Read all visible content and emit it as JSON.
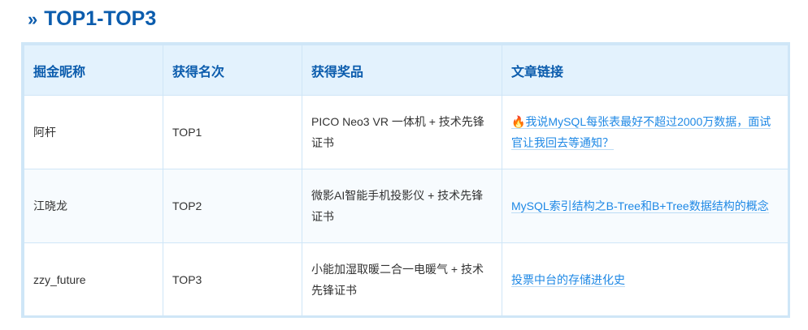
{
  "heading": {
    "marker": "»",
    "title": "TOP1-TOP3"
  },
  "table": {
    "columns": [
      "掘金昵称",
      "获得名次",
      "获得奖品",
      "文章链接"
    ],
    "rows": [
      {
        "nickname": "阿杆",
        "rank": "TOP1",
        "prize": "PICO Neo3 VR 一体机 + 技术先锋证书",
        "article_icon": "🔥",
        "article": "我说MySQL每张表最好不超过2000万数据，面试官让我回去等通知？"
      },
      {
        "nickname": "江晓龙",
        "rank": "TOP2",
        "prize": "微影AI智能手机投影仪 + 技术先锋证书",
        "article_icon": "",
        "article": "MySQL索引结构之B-Tree和B+Tree数据结构的概念"
      },
      {
        "nickname": "zzy_future",
        "rank": "TOP3",
        "prize": "小能加湿取暖二合一电暖气 + 技术先锋证书",
        "article_icon": "",
        "article": "投票中台的存储进化史"
      }
    ]
  },
  "colors": {
    "heading": "#0b5cad",
    "header_bg": "#e3f2fd",
    "border": "#cfe6f7",
    "link": "#1e88e5"
  }
}
